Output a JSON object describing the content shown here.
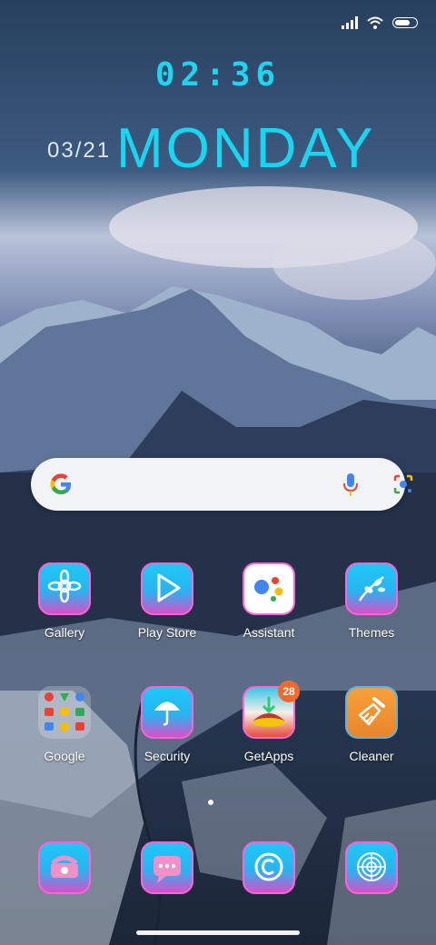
{
  "status_bar": {
    "icons": [
      "signal-icon",
      "wifi-icon",
      "battery-icon"
    ],
    "battery_level": 0.75
  },
  "clock": {
    "time": "02:36",
    "date": "03/21",
    "day": "MONDAY"
  },
  "search_bar": {
    "icons": [
      "google-logo-icon",
      "mic-icon",
      "lens-camera-icon"
    ]
  },
  "apps": [
    {
      "label": "Gallery",
      "icon": "gallery-icon"
    },
    {
      "label": "Play Store",
      "icon": "play-store-icon"
    },
    {
      "label": "Assistant",
      "icon": "assistant-icon"
    },
    {
      "label": "Themes",
      "icon": "themes-icon"
    },
    {
      "label": "Google",
      "icon": "google-folder-icon"
    },
    {
      "label": "Security",
      "icon": "security-icon"
    },
    {
      "label": "GetApps",
      "icon": "getapps-icon",
      "badge": "28"
    },
    {
      "label": "Cleaner",
      "icon": "cleaner-icon"
    }
  ],
  "dock": [
    {
      "icon": "phone-icon"
    },
    {
      "icon": "messages-icon"
    },
    {
      "icon": "copyright-icon"
    },
    {
      "icon": "target-icon"
    }
  ],
  "colors": {
    "accent_cyan": "#18d6f2",
    "icon_border_pink": "#ff63d8",
    "badge_orange": "#f6692d"
  }
}
